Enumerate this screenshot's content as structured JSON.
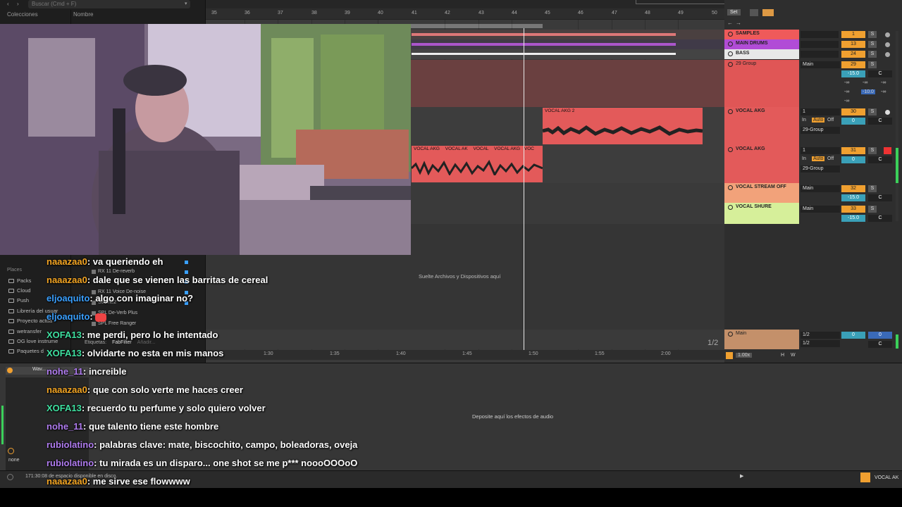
{
  "browser": {
    "search_placeholder": "Buscar (Cmd + F)",
    "collections_label": "Colecciones",
    "name_header": "Nombre",
    "places_title": "Places",
    "places": [
      "Packs",
      "Cloud",
      "Push",
      "Librería del usuar",
      "Proyecto actua",
      "wetransfer",
      "OG love instrume",
      "Paquetes d"
    ],
    "devices": [
      "RX 11 De-reverb",
      "RX 11 Voice De-noise",
      "Soothe2",
      "SPL De-Verb Plus",
      "SPL Free Ranger"
    ],
    "tags_label": "Etiquetas:",
    "tags_value": "FabFilter",
    "tags_more": "Añadir..."
  },
  "arranger": {
    "bars": [
      "35",
      "36",
      "37",
      "38",
      "39",
      "40",
      "41",
      "42",
      "43",
      "44",
      "45",
      "46",
      "47",
      "48",
      "49",
      "50"
    ],
    "set_label": "Set",
    "clips": {
      "vocal_akg2": "VOCAL AKG 2",
      "vocal_akg_row": [
        "VOCAL AKG",
        "VOCAL AK",
        "VOCAL",
        "VOCAL AKG",
        "VOC"
      ]
    },
    "drop_text": "Suelte Archivos y Dispositivos aquí",
    "page_indicator": "1/2",
    "time_labels": [
      "1:30",
      "1:35",
      "1:40",
      "1:45",
      "1:50",
      "1:55",
      "2:00"
    ],
    "zoom": "1.00x",
    "h_label": "H",
    "w_label": "W"
  },
  "mixer": {
    "tracks": [
      {
        "name": "SAMPLES",
        "num": "1",
        "s": "S",
        "color": "#ef5a5a"
      },
      {
        "name": "MAIN DRUMS",
        "num": "13",
        "s": "S",
        "color": "#b14cd6"
      },
      {
        "name": "BASS",
        "num": "24",
        "s": "S",
        "color": "#e8e8e8"
      },
      {
        "name": "29 Group",
        "num": "29",
        "s": "S",
        "color": "#d9534f",
        "route": "Main",
        "vol": "-15.0",
        "pan": "C",
        "sends": [
          "-∞",
          "-∞",
          "-∞",
          "-∞",
          "-10.0",
          "-∞",
          "-∞"
        ]
      },
      {
        "name": "VOCAL AKG",
        "num": "30",
        "s": "S",
        "color": "#e35a5a",
        "input": "1",
        "in": "In",
        "auto": "Auto",
        "off": "Off",
        "route": "29-Group",
        "vol": "0",
        "pan": "C"
      },
      {
        "name": "VOCAL AKG",
        "num": "31",
        "s": "S",
        "color": "#e35a5a",
        "input": "1",
        "in": "In",
        "auto": "Auto",
        "off": "Off",
        "route": "29-Group",
        "vol": "0",
        "pan": "C"
      },
      {
        "name": "VOCAL STREAM OFF",
        "num": "32",
        "s": "S",
        "color": "#f2a27a",
        "route": "Main",
        "vol": "-15.0",
        "pan": "C"
      },
      {
        "name": "VOCAL SHURE",
        "num": "33",
        "s": "S",
        "color": "#d6ef9a",
        "route": "Main",
        "vol": "-15.0",
        "pan": "C"
      }
    ],
    "main": {
      "name": "Main",
      "input1": "1/2",
      "input2": "1/2",
      "vol": "0",
      "vol2": "0",
      "pan": "C"
    }
  },
  "detail": {
    "device_name": "Wav...",
    "drop_text": "Deposite aquí los efectos de audio",
    "none_label": "none"
  },
  "status": {
    "disk": "171:30:08 de espacio disponible en disco.",
    "right_label": "VOCAL AK"
  },
  "chat": [
    {
      "user": "naaazaa0",
      "text": ": va queriendo eh",
      "color": "orange"
    },
    {
      "user": "naaazaa0",
      "text": ": dale que se vienen las barritas de cereal",
      "color": "orange"
    },
    {
      "user": "eljoaquito",
      "text": ": algo con imaginar no?",
      "color": "blue"
    },
    {
      "user": "eljoaquito",
      "text": ":",
      "color": "blue"
    },
    {
      "user": "XOFA13",
      "text": ": me perdi, pero lo he intentado",
      "color": "green"
    },
    {
      "user": "XOFA13",
      "text": ": olvidarte no esta en mis manos",
      "color": "green"
    },
    {
      "user": "nohe_11",
      "text": ": increible",
      "color": "purple"
    },
    {
      "user": "naaazaa0",
      "text": ": que con solo verte me haces creer",
      "color": "orange"
    },
    {
      "user": "XOFA13",
      "text": ": recuerdo tu perfume y solo quiero volver",
      "color": "green"
    },
    {
      "user": "nohe_11",
      "text": ": que talento tiene este hombre",
      "color": "purple"
    },
    {
      "user": "rubiolatino",
      "text": ": palabras clave: mate, biscochito, campo, boleadoras, oveja",
      "color": "purple"
    },
    {
      "user": "rubiolatino",
      "text": ": tu mirada es un disparo... one shot se me p*** noooOOOoO",
      "color": "purple"
    },
    {
      "user": "naaazaa0",
      "text": ": me sirve ese flowwww",
      "color": "orange"
    }
  ]
}
